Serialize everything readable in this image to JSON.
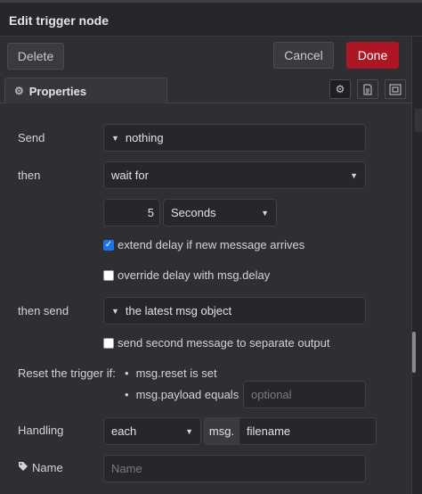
{
  "window": {
    "title": "Edit trigger node"
  },
  "toolbar": {
    "delete_label": "Delete",
    "cancel_label": "Cancel",
    "done_label": "Done"
  },
  "tabs": {
    "properties_label": "Properties"
  },
  "form": {
    "send": {
      "label": "Send",
      "value": "nothing"
    },
    "then": {
      "label": "then",
      "value": "wait for"
    },
    "delay": {
      "amount": "5",
      "unit": "Seconds"
    },
    "extend_delay": {
      "label": "extend delay if new message arrives",
      "checked": true
    },
    "override_delay": {
      "label": "override delay with msg.delay",
      "checked": false
    },
    "then_send": {
      "label": "then send",
      "value": "the latest msg object"
    },
    "second_output": {
      "label": "send second message to separate output",
      "checked": false
    },
    "reset": {
      "label": "Reset the trigger if:",
      "rule_1": "msg.reset is set",
      "rule_2": "msg.payload equals",
      "placeholder": "optional"
    },
    "handling": {
      "label": "Handling",
      "mode": "each",
      "prefix": "msg.",
      "property": "filename"
    },
    "name": {
      "label": "Name",
      "placeholder": "Name"
    }
  },
  "colors": {
    "done": "#ad1625",
    "checkbox": "#1a73e8",
    "panel": "#2e2e33",
    "field": "#26262b"
  },
  "icons": [
    "gear-icon",
    "info-icon",
    "description-icon",
    "appearance-icon",
    "caret-right-icon",
    "chevron-down-icon",
    "tag-icon",
    "check-icon"
  ]
}
